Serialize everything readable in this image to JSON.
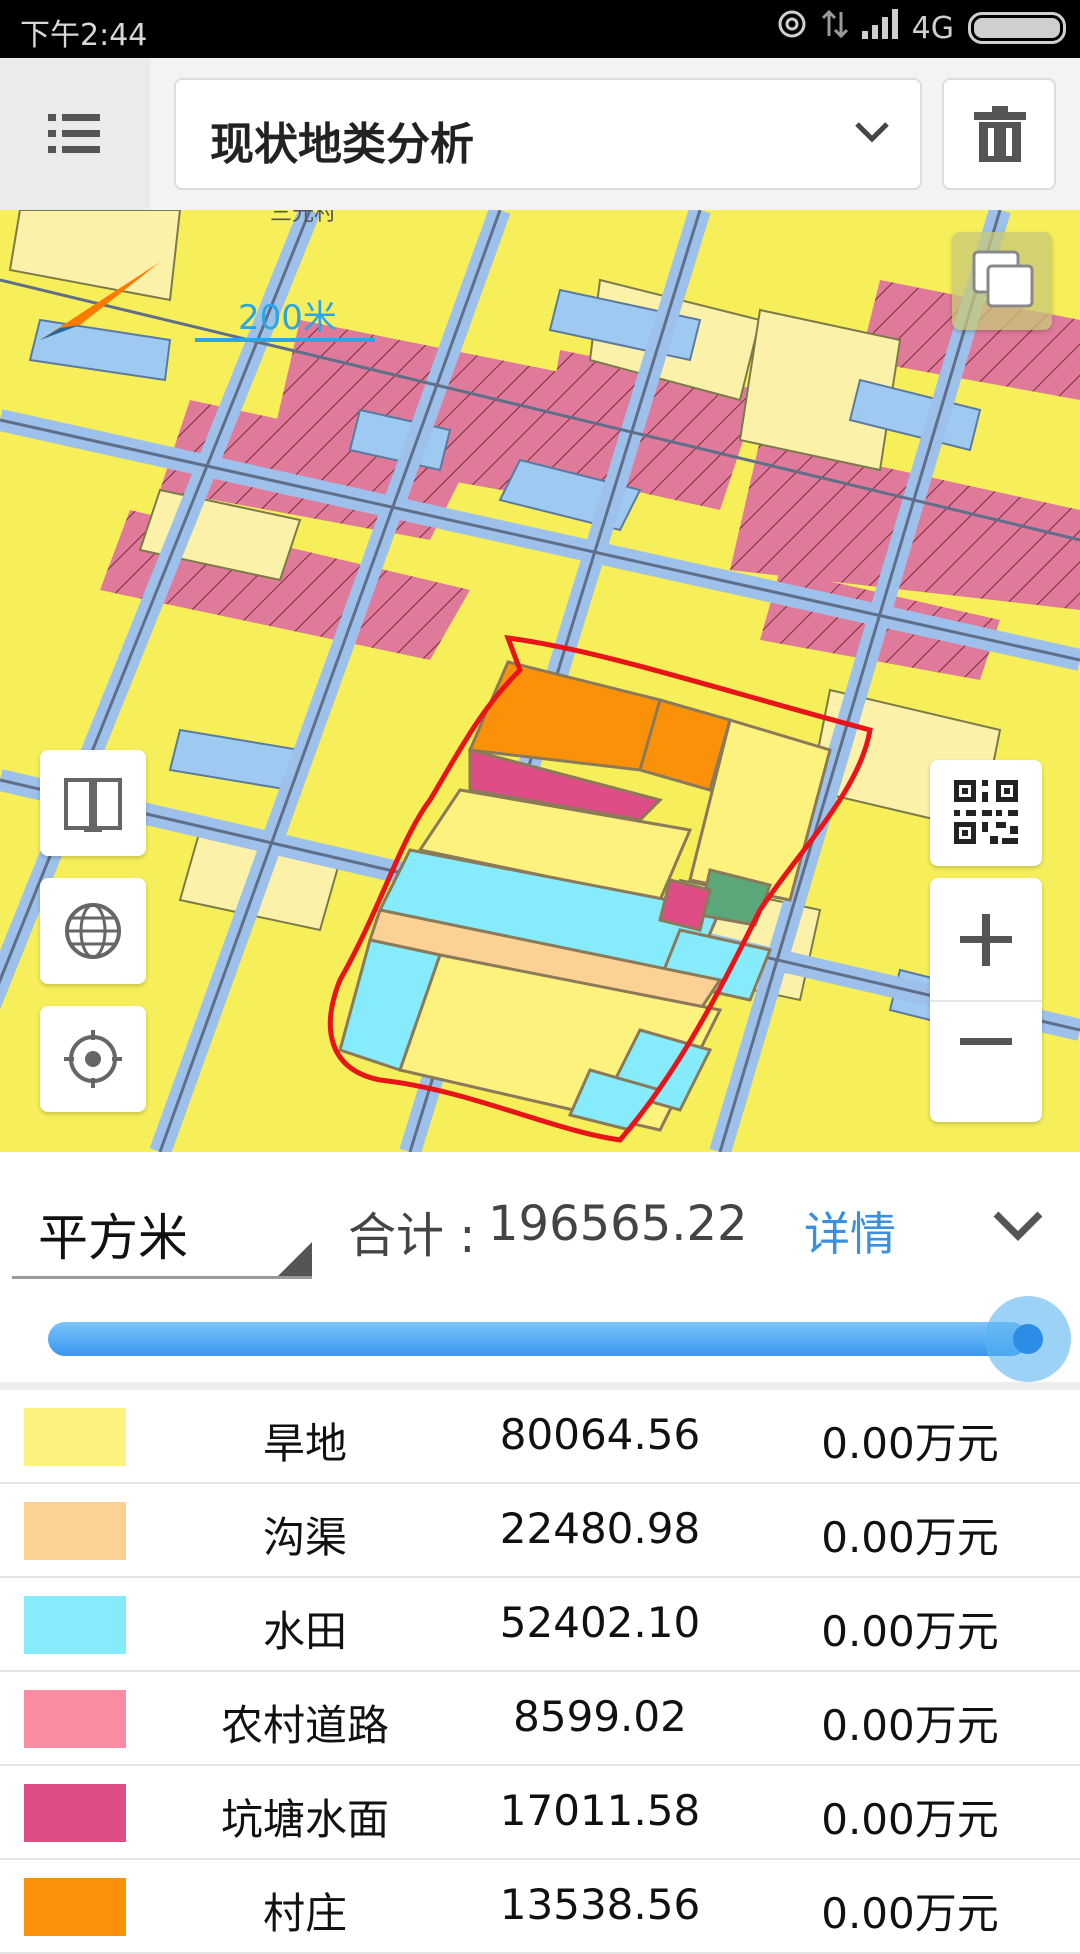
{
  "status_bar": {
    "time": "下午2:44",
    "network": "4G"
  },
  "toolbar": {
    "menu_icon": "list-icon",
    "analysis_selector": {
      "selected": "现状地类分析"
    },
    "delete_icon": "trash-icon"
  },
  "map": {
    "scale_label": "200米",
    "village_label": "三光村",
    "colors": {
      "dryland": "#f6ef5a",
      "road": "#a8c8ee",
      "water": "#9ec9f0",
      "residential": "#e07a9a",
      "boundary": "#e8141a"
    },
    "controls": [
      "layers-icon",
      "book-icon",
      "globe-icon",
      "locate-icon",
      "qr-code-icon",
      "zoom-in-icon",
      "zoom-out-icon"
    ]
  },
  "summary": {
    "unit": "平方米",
    "total_label": "合计 :",
    "total_value": "196565.22",
    "details_label": "详情",
    "slider_fraction": 1.0
  },
  "legend": [
    {
      "name": "旱地",
      "area": "80064.56",
      "cost": "0.00万元",
      "color": "#fdf27d"
    },
    {
      "name": "沟渠",
      "area": "22480.98",
      "cost": "0.00万元",
      "color": "#fcd294"
    },
    {
      "name": "水田",
      "area": "52402.10",
      "cost": "0.00万元",
      "color": "#86ecfc"
    },
    {
      "name": "农村道路",
      "area": "8599.02",
      "cost": "0.00万元",
      "color": "#fb8ca2"
    },
    {
      "name": "坑塘水面",
      "area": "17011.58",
      "cost": "0.00万元",
      "color": "#df4d86"
    },
    {
      "name": "村庄",
      "area": "13538.56",
      "cost": "0.00万元",
      "color": "#fb9109"
    }
  ]
}
